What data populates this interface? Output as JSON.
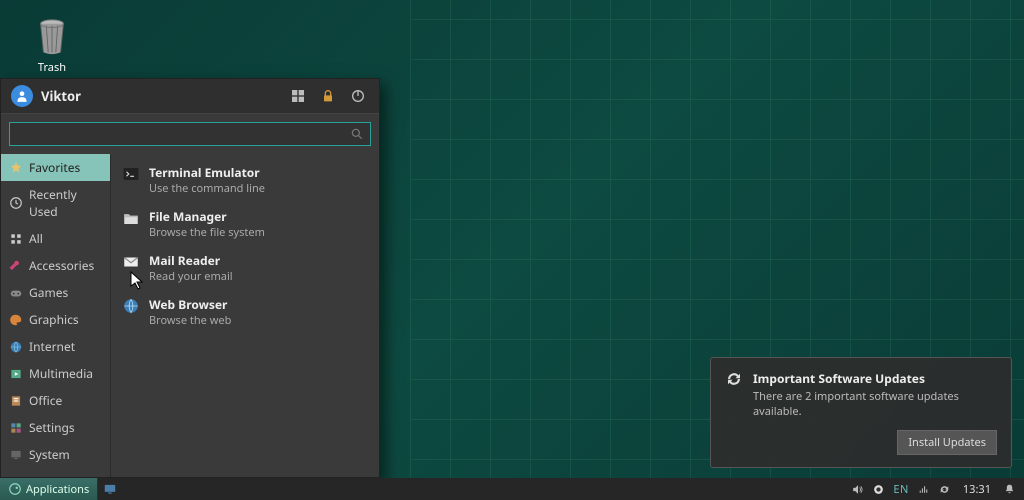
{
  "desktop": {
    "trash_label": "Trash"
  },
  "menu": {
    "username": "Viktor",
    "search_placeholder": "",
    "categories": [
      {
        "icon": "star",
        "label": "Favorites",
        "active": true
      },
      {
        "icon": "clock",
        "label": "Recently Used"
      },
      {
        "icon": "grid",
        "label": "All"
      },
      {
        "icon": "tools",
        "label": "Accessories"
      },
      {
        "icon": "game",
        "label": "Games"
      },
      {
        "icon": "palette",
        "label": "Graphics"
      },
      {
        "icon": "globe",
        "label": "Internet"
      },
      {
        "icon": "media",
        "label": "Multimedia"
      },
      {
        "icon": "office",
        "label": "Office"
      },
      {
        "icon": "settings",
        "label": "Settings"
      },
      {
        "icon": "system",
        "label": "System"
      }
    ],
    "apps": [
      {
        "icon": "terminal",
        "title": "Terminal Emulator",
        "desc": "Use the command line"
      },
      {
        "icon": "folder",
        "title": "File Manager",
        "desc": "Browse the file system"
      },
      {
        "icon": "mail",
        "title": "Mail Reader",
        "desc": "Read your email"
      },
      {
        "icon": "browser",
        "title": "Web Browser",
        "desc": "Browse the web"
      }
    ]
  },
  "notification": {
    "title": "Important Software Updates",
    "body": "There are 2 important software updates available.",
    "button": "Install Updates"
  },
  "taskbar": {
    "app_button": "Applications",
    "language": "EN",
    "clock": "13:31"
  }
}
